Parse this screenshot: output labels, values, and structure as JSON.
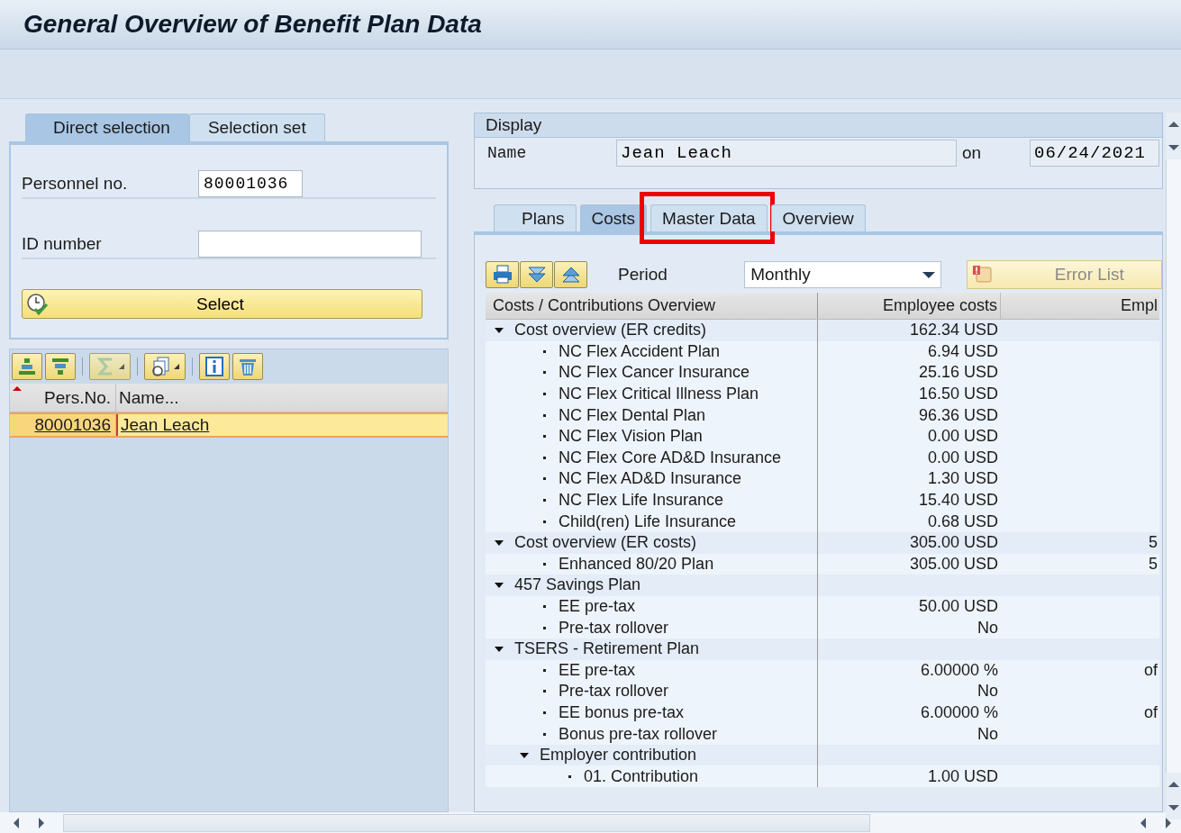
{
  "window": {
    "title": "General Overview of Benefit Plan Data"
  },
  "left_panel": {
    "tabs": [
      {
        "label": "Direct selection",
        "selected": true
      },
      {
        "label": "Selection set",
        "selected": false
      }
    ],
    "fields": [
      {
        "label": "Personnel no.",
        "value": "80001036",
        "kind": "short"
      },
      {
        "label": "ID number",
        "kind": "long"
      }
    ],
    "select_button": "Select",
    "list": {
      "columns": [
        "Pers.No.",
        "Name..."
      ],
      "rows": [
        {
          "pers_no": "80001036",
          "name": "Jean Leach",
          "selected": true
        }
      ]
    }
  },
  "display": {
    "title": "Display",
    "name_label": "Name",
    "name_value": "Jean Leach",
    "on_label": "on",
    "date": "06/24/2021"
  },
  "tabs": [
    {
      "label": "Plans",
      "selected": false,
      "highlighted": false
    },
    {
      "label": "Costs",
      "selected": true,
      "highlighted": false
    },
    {
      "label": "Master Data",
      "selected": false,
      "highlighted": true
    },
    {
      "label": "Overview",
      "selected": false,
      "highlighted": false
    }
  ],
  "toolbar": {
    "period_label": "Period",
    "period_value": "Monthly",
    "error_list": {
      "label": "Error List",
      "disabled": true
    }
  },
  "tree": {
    "columns": [
      "Costs / Contributions Overview",
      "Employee costs",
      "Empl"
    ],
    "rows": [
      {
        "label": "Cost overview (ER credits)",
        "value": "162.34 USD",
        "expanded": true,
        "children": [
          {
            "label": "NC Flex Accident Plan",
            "value": "6.94 USD"
          },
          {
            "label": "NC Flex Cancer Insurance",
            "value": "25.16 USD"
          },
          {
            "label": "NC Flex Critical Illness Plan",
            "value": "16.50 USD"
          },
          {
            "label": "NC Flex Dental Plan",
            "value": "96.36 USD"
          },
          {
            "label": "NC Flex Vision Plan",
            "value": "0.00 USD"
          },
          {
            "label": "NC Flex Core AD&D Insurance",
            "value": "0.00 USD"
          },
          {
            "label": "NC Flex AD&D Insurance",
            "value": "1.30 USD"
          },
          {
            "label": "NC Flex Life Insurance",
            "value": "15.40 USD"
          },
          {
            "label": "Child(ren) Life Insurance",
            "value": "0.68 USD"
          }
        ]
      },
      {
        "label": "Cost overview (ER costs)",
        "value": "305.00 USD",
        "column_3": "5",
        "expanded": true,
        "children": [
          {
            "label": "Enhanced 80/20 Plan",
            "value": "305.00 USD",
            "column_3": "5"
          }
        ]
      },
      {
        "label": "457 Savings Plan",
        "expanded": true,
        "children": [
          {
            "label": "EE pre-tax",
            "value": "50.00 USD"
          },
          {
            "label": "Pre-tax rollover",
            "value": "No"
          }
        ]
      },
      {
        "label": "TSERS - Retirement Plan",
        "expanded": true,
        "children": [
          {
            "label": "EE pre-tax",
            "value": "6.00000 %",
            "column_3": "of"
          },
          {
            "label": "Pre-tax rollover",
            "value": "No"
          },
          {
            "label": "EE bonus pre-tax",
            "value": "6.00000 %",
            "column_3": "of"
          },
          {
            "label": "Bonus pre-tax rollover",
            "value": "No"
          },
          {
            "label": "Employer contribution",
            "expanded": true,
            "children": [
              {
                "label": "01. Contribution",
                "value": "1.00 USD"
              }
            ]
          }
        ]
      }
    ]
  }
}
